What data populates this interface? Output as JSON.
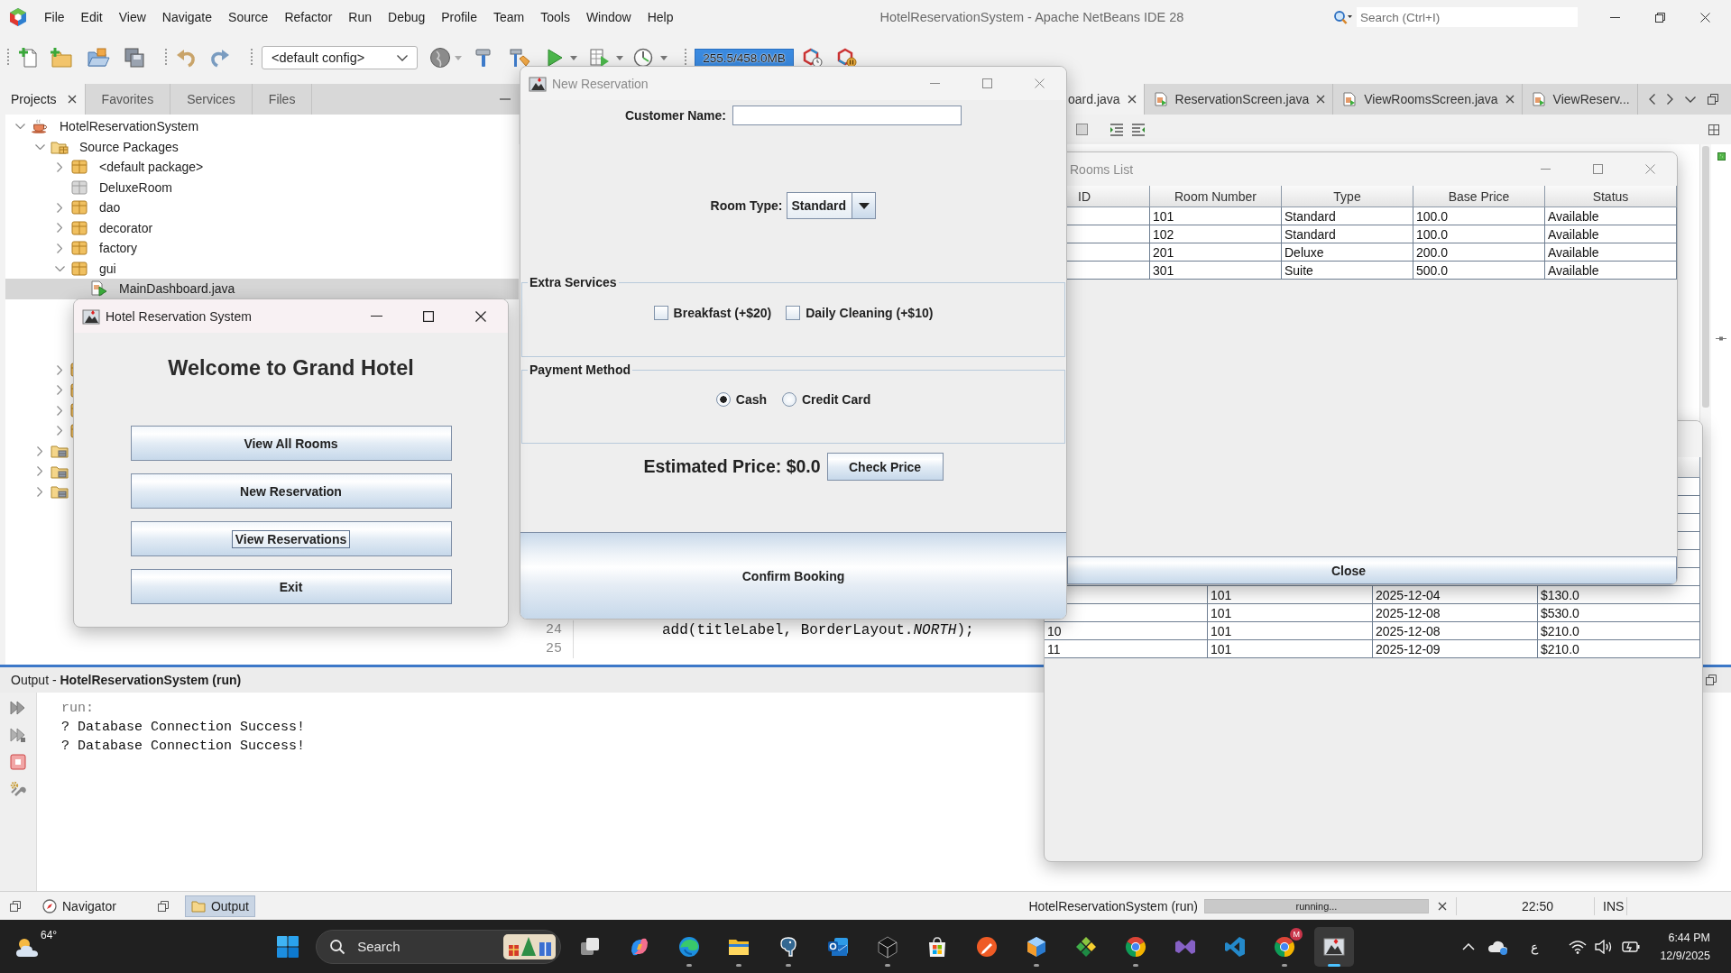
{
  "menubar": {
    "menus": [
      "File",
      "Edit",
      "View",
      "Navigate",
      "Source",
      "Refactor",
      "Run",
      "Debug",
      "Profile",
      "Team",
      "Tools",
      "Window",
      "Help"
    ],
    "title": "HotelReservationSystem - Apache NetBeans IDE 28",
    "search": {
      "placeholder": "Search (Ctrl+I)"
    }
  },
  "toolbar": {
    "config": "<default config>",
    "memory": "255.5/458.0MB"
  },
  "projects": {
    "tabs": [
      {
        "label": "Projects",
        "selected": true
      },
      {
        "label": "Favorites",
        "selected": false
      },
      {
        "label": "Services",
        "selected": false
      },
      {
        "label": "Files",
        "selected": false
      }
    ],
    "tree": [
      {
        "label": "HotelReservationSystem",
        "kind": "project",
        "expanded": true,
        "selected": false,
        "children": [
          {
            "label": "Source Packages",
            "kind": "source-folder",
            "expanded": true,
            "selected": false,
            "children": [
              {
                "label": "<default package>",
                "kind": "package",
                "expanded": false,
                "selected": false
              },
              {
                "label": "DeluxeRoom",
                "kind": "empty-package",
                "selected": false
              },
              {
                "label": "dao",
                "kind": "package",
                "expanded": false,
                "selected": false
              },
              {
                "label": "decorator",
                "kind": "package",
                "expanded": false,
                "selected": false
              },
              {
                "label": "factory",
                "kind": "package",
                "expanded": false,
                "selected": false
              },
              {
                "label": "gui",
                "kind": "package",
                "expanded": true,
                "selected": false,
                "children": [
                  {
                    "label": "MainDashboard.java",
                    "kind": "java-file",
                    "selected": true
                  }
                ]
              },
              {
                "kind": "package",
                "expanded": false
              },
              {
                "kind": "package",
                "expanded": false
              },
              {
                "kind": "package",
                "expanded": false
              },
              {
                "kind": "package",
                "expanded": false
              }
            ]
          },
          {
            "kind": "folder",
            "expanded": false
          },
          {
            "kind": "folder",
            "expanded": false
          },
          {
            "kind": "folder",
            "expanded": false
          }
        ]
      }
    ]
  },
  "editor": {
    "tabs": [
      {
        "label": "oard.java",
        "selected": true,
        "clipped": true,
        "closable": true
      },
      {
        "label": "ReservationScreen.java",
        "selected": false,
        "clipped": false,
        "closable": true
      },
      {
        "label": "ViewRoomsScreen.java",
        "selected": false,
        "clipped": false,
        "closable": true
      },
      {
        "label": "ViewReserv...",
        "selected": false,
        "clipped": false,
        "closable": false
      }
    ],
    "lines": [
      {
        "number": "24",
        "code": "add(titleLabel, BorderLayout.*NORTH*);"
      },
      {
        "number": "25"
      }
    ]
  },
  "output": {
    "title": "Output - **HotelReservationSystem (run)**",
    "lines": [
      {
        "text": "run:",
        "kind": "meta"
      },
      {
        "text": "? Database Connection Success!",
        "kind": "stdout"
      },
      {
        "text": "? Database Connection Success!",
        "kind": "stdout"
      }
    ]
  },
  "statusbar": {
    "tabs": [
      {
        "label": "Navigator",
        "kind": "navigator",
        "selected": false
      },
      {
        "label": "Output",
        "kind": "output",
        "selected": true
      }
    ],
    "task": "HotelReservationSystem (run)",
    "progress": "running...",
    "position": "22:50",
    "mode": "INS"
  },
  "taskbar": {
    "weather": "64°",
    "search": {
      "placeholder": "Search"
    },
    "apps": [
      {
        "kind": "stacked-squares",
        "running": false,
        "active": false
      },
      {
        "kind": "swirl",
        "running": false,
        "active": false
      },
      {
        "kind": "wave-circle",
        "running": true,
        "active": false
      },
      {
        "kind": "folder",
        "running": true,
        "active": false
      },
      {
        "kind": "elephant",
        "running": true,
        "active": false
      },
      {
        "kind": "envelope",
        "running": false,
        "active": false
      },
      {
        "kind": "cube",
        "running": true,
        "active": false
      },
      {
        "kind": "shopping-bag",
        "running": false,
        "active": false
      },
      {
        "kind": "pen-circle",
        "running": false,
        "active": false
      },
      {
        "kind": "hexagon-cube",
        "running": true,
        "active": false
      },
      {
        "kind": "leaf-cluster",
        "running": false,
        "active": false
      },
      {
        "kind": "segmented-circle",
        "running": true,
        "active": false
      },
      {
        "kind": "bowtie",
        "running": false,
        "active": false
      },
      {
        "kind": "ribbon",
        "running": false,
        "active": false
      },
      {
        "kind": "segmented-circle",
        "running": true,
        "active": false,
        "badge": "M"
      },
      {
        "kind": "app-window",
        "running": true,
        "active": true
      }
    ],
    "language": "ع",
    "time": "6:44 PM",
    "date": "12/9/2025"
  },
  "dashboard_window": {
    "title": "Hotel Reservation System",
    "active": true,
    "heading": "Welcome to Grand Hotel",
    "buttons": [
      {
        "label": "View All Rooms",
        "focused": false
      },
      {
        "label": "New Reservation",
        "focused": false
      },
      {
        "label": "View Reservations",
        "focused": true
      },
      {
        "label": "Exit",
        "focused": false
      }
    ]
  },
  "reservation_window": {
    "title": "New Reservation",
    "active": false,
    "customer": {
      "label": "Customer Name:"
    },
    "room_type": {
      "label": "Room Type:",
      "value": "Standard"
    },
    "extras": {
      "title": "Extra Services",
      "options": [
        {
          "label": "Breakfast (+$20)",
          "checked": false
        },
        {
          "label": "Daily Cleaning (+$10)",
          "checked": false
        }
      ]
    },
    "payment": {
      "title": "Payment Method",
      "options": [
        {
          "label": "Cash",
          "selected": true
        },
        {
          "label": "Credit Card",
          "selected": false
        }
      ]
    },
    "estimate": "Estimated Price: $0.0",
    "check_button": "Check Price",
    "confirm_button": "Confirm Booking"
  },
  "rooms_window": {
    "title": "Rooms List",
    "active": false,
    "columns": [
      "ID",
      "Room Number",
      "Type",
      "Base Price",
      "Status"
    ],
    "rows": [
      {
        "room_number": "101",
        "type": "Standard",
        "base_price": "100.0",
        "status": "Available"
      },
      {
        "room_number": "102",
        "type": "Standard",
        "base_price": "100.0",
        "status": "Available"
      },
      {
        "room_number": "201",
        "type": "Deluxe",
        "base_price": "200.0",
        "status": "Available"
      },
      {
        "room_number": "301",
        "type": "Suite",
        "base_price": "500.0",
        "status": "Available"
      }
    ],
    "close_button": "Close"
  },
  "reservations_window": {
    "rows": [
      {
        "room": "101",
        "date": "2025-12-04",
        "price": "$130.0"
      },
      {
        "room": "101",
        "date": "2025-12-08",
        "price": "$530.0"
      },
      {
        "id": "10",
        "room": "101",
        "date": "2025-12-08",
        "price": "$210.0"
      },
      {
        "id": "11",
        "room": "101",
        "date": "2025-12-09",
        "price": "$210.0"
      }
    ]
  }
}
